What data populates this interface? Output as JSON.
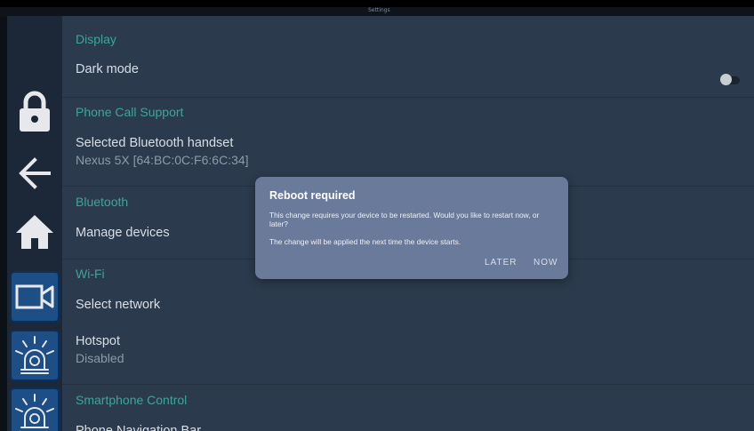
{
  "status_bar": {
    "title": "Settings"
  },
  "rail": {
    "items": [
      {
        "icon": "lock-icon"
      },
      {
        "icon": "back-arrow-icon"
      },
      {
        "icon": "home-icon"
      },
      {
        "icon": "camera-icon"
      },
      {
        "icon": "siren-icon"
      },
      {
        "icon": "siren-icon"
      }
    ]
  },
  "sections": {
    "display": {
      "header": "Display",
      "dark_mode": {
        "title": "Dark mode",
        "enabled": false
      }
    },
    "phone": {
      "header": "Phone Call Support",
      "handset": {
        "title": "Selected Bluetooth handset",
        "value": "Nexus 5X [64:BC:0C:F6:6C:34]"
      }
    },
    "bluetooth": {
      "header": "Bluetooth",
      "manage": {
        "title": "Manage devices"
      }
    },
    "wifi": {
      "header": "Wi-Fi",
      "select": {
        "title": "Select network"
      },
      "hotspot": {
        "title": "Hotspot",
        "value": "Disabled"
      }
    },
    "smartphone": {
      "header": "Smartphone Control",
      "nav_bar": {
        "title": "Phone Navigation Bar"
      }
    }
  },
  "dialog": {
    "title": "Reboot required",
    "message": "This change requires your device to be restarted. Would you like to restart now, or later?",
    "note": "The change will be applied the next time the device starts.",
    "later_label": "LATER",
    "now_label": "NOW"
  }
}
